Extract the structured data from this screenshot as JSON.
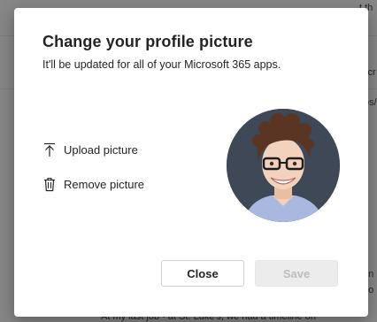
{
  "background": {
    "fragments": [
      "t th",
      "scr",
      "os/",
      "on",
      "no",
      "At my last job - at St. Luke's, we had a timeline on"
    ]
  },
  "dialog": {
    "title": "Change your profile picture",
    "subtitle": "It'll be updated for all of your Microsoft 365 apps.",
    "actions": {
      "upload": {
        "label": "Upload picture",
        "icon": "upload-icon"
      },
      "remove": {
        "label": "Remove picture",
        "icon": "trash-icon"
      }
    },
    "avatar": {
      "alt": "Profile picture"
    },
    "buttons": {
      "close": "Close",
      "save": "Save"
    }
  },
  "colors": {
    "text": "#242424",
    "avatar_bg": "#3e4856",
    "save_disabled_bg": "#ececec",
    "save_disabled_text": "#bdbdbd"
  }
}
